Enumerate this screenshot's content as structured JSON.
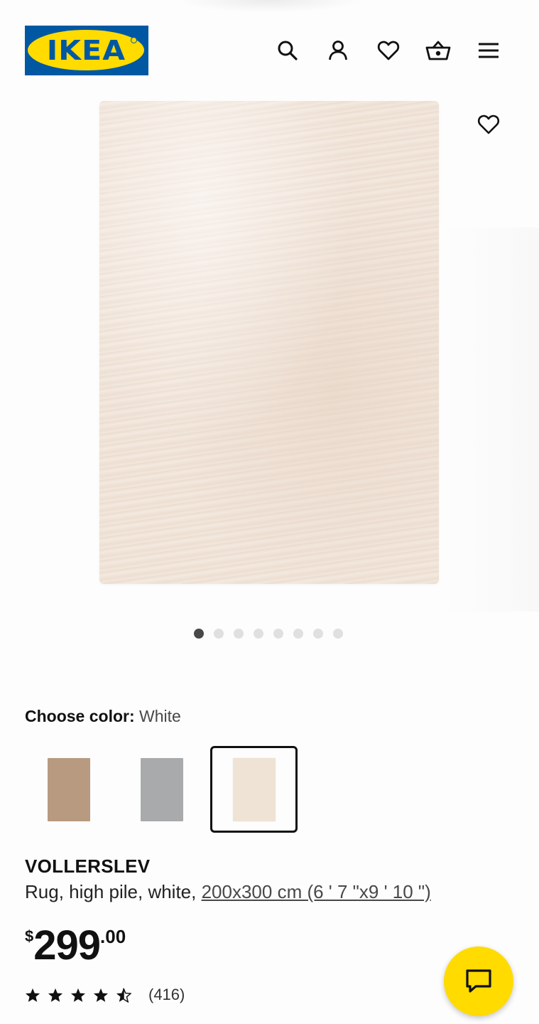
{
  "header": {
    "logo_text": "IKEA",
    "icons": [
      "search-icon",
      "account-icon",
      "heart-icon",
      "basket-icon",
      "menu-icon"
    ]
  },
  "gallery": {
    "slide_count": 8,
    "active_slide": 1,
    "favorite_icon": "heart-icon"
  },
  "color_picker": {
    "label": "Choose color:",
    "selected_value": "White",
    "swatch_colors": [
      "#b89a80",
      "#a9aaab",
      "#efe3d6"
    ],
    "selected_index": 2
  },
  "product": {
    "name": "VOLLERSLEV",
    "description": "Rug, high pile, white, ",
    "size_link": "200x300 cm (6 ' 7 \"x9 ' 10 \")"
  },
  "price": {
    "currency": "$",
    "integer": "299",
    "decimal": ".00"
  },
  "rating": {
    "stars": 4.5,
    "max_stars": 5,
    "count_text": "(416)"
  },
  "chat": {
    "icon": "chat-icon"
  },
  "colors": {
    "ikea_blue": "#0058a3",
    "ikea_yellow": "#ffdb00"
  }
}
